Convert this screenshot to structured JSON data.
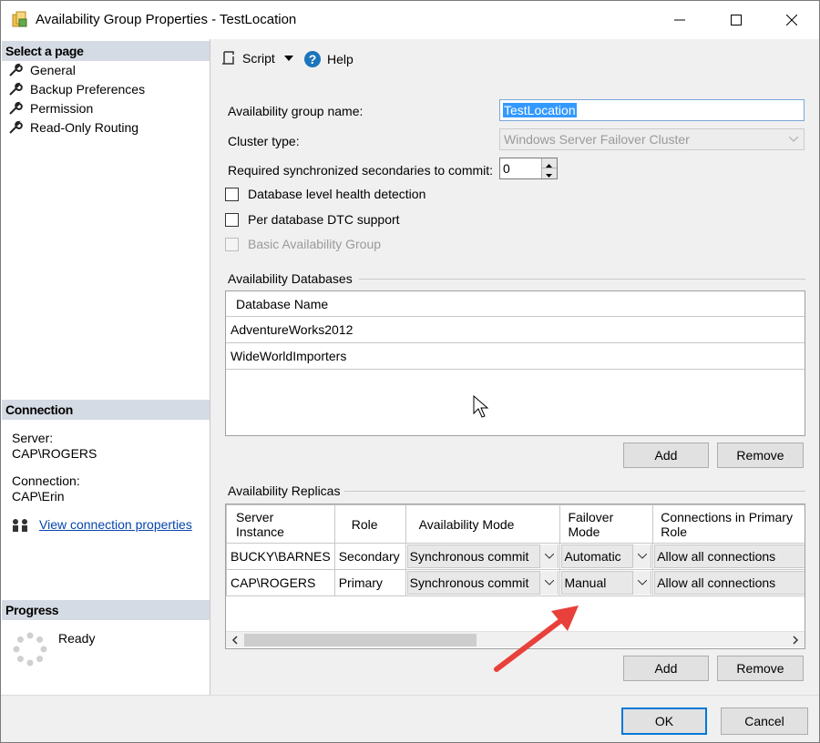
{
  "window": {
    "title": "Availability Group Properties - TestLocation"
  },
  "left": {
    "select_page_header": "Select a page",
    "pages": [
      "General",
      "Backup Preferences",
      "Permission",
      "Read-Only Routing"
    ],
    "connection_header": "Connection",
    "server_label": "Server:",
    "server_value": "CAP\\ROGERS",
    "connection_label": "Connection:",
    "connection_value": "CAP\\Erin",
    "view_connection_link": "View connection properties",
    "progress_header": "Progress",
    "progress_status": "Ready"
  },
  "toolbar": {
    "script_label": "Script",
    "help_label": "Help"
  },
  "form": {
    "ag_name_label": "Availability group name:",
    "ag_name_value": "TestLocation",
    "cluster_type_label": "Cluster type:",
    "cluster_type_value": "Windows Server Failover Cluster",
    "req_sync_label": "Required synchronized secondaries to commit:",
    "req_sync_value": "0",
    "check_db_health": "Database level health detection",
    "check_dtc": "Per database DTC support",
    "check_basic": "Basic Availability Group"
  },
  "databases": {
    "group_label": "Availability Databases",
    "column": "Database Name",
    "rows": [
      "AdventureWorks2012",
      "WideWorldImporters"
    ],
    "add_label": "Add",
    "remove_label": "Remove"
  },
  "replicas": {
    "group_label": "Availability Replicas",
    "columns": {
      "server_instance_1": "Server",
      "server_instance_2": "Instance",
      "role": "Role",
      "availability_mode": "Availability Mode",
      "failover_1": "Failover",
      "failover_2": "Mode",
      "connections_1": "Connections in Primary",
      "connections_2": "Role"
    },
    "rows": [
      {
        "server": "BUCKY\\BARNES",
        "role": "Secondary",
        "mode": "Synchronous commit",
        "failover": "Automatic",
        "connections": "Allow all connections"
      },
      {
        "server": "CAP\\ROGERS",
        "role": "Primary",
        "mode": "Synchronous commit",
        "failover": "Manual",
        "connections": "Allow all connections"
      }
    ],
    "add_label": "Add",
    "remove_label": "Remove"
  },
  "footer": {
    "ok_label": "OK",
    "cancel_label": "Cancel"
  },
  "colors": {
    "arrow": "#e8403a",
    "accent": "#0078d7",
    "link": "#0645ad"
  }
}
